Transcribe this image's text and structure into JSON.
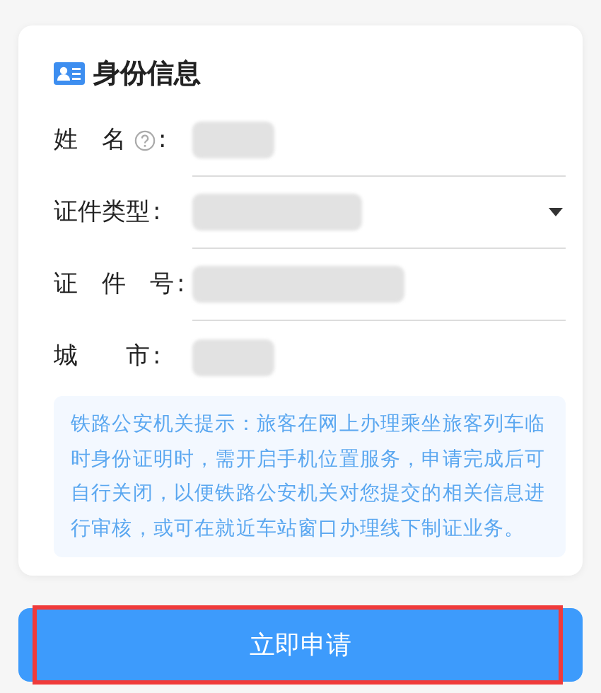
{
  "section": {
    "title": "身份信息"
  },
  "fields": [
    {
      "label": "姓　名",
      "kind": "text",
      "help": true,
      "colon": ":",
      "redacted": true
    },
    {
      "label": "证件类型",
      "kind": "select",
      "help": false,
      "colon": ":",
      "redacted": true
    },
    {
      "label": "证　件　号",
      "kind": "text",
      "help": false,
      "colon": ":",
      "redacted": true
    },
    {
      "label": "城　　市",
      "kind": "text",
      "help": false,
      "colon": ":",
      "redacted": true
    }
  ],
  "notice": "铁路公安机关提示：旅客在网上办理乘坐旅客列车临时身份证明时，需开启手机位置服务，申请完成后可自行关闭，以便铁路公安机关对您提交的相关信息进行审核，或可在就近车站窗口办理线下制证业务。",
  "submit_button": {
    "label": "立即申请",
    "highlighted": true
  }
}
